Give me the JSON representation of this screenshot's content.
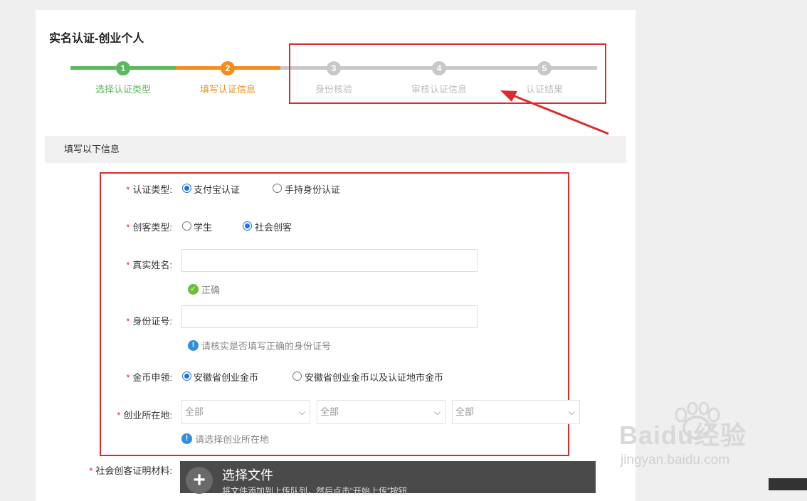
{
  "page": {
    "title": "实名认证-创业个人"
  },
  "steps": [
    {
      "number": "1",
      "label": "选择认证类型",
      "color": "#5cb85c"
    },
    {
      "number": "2",
      "label": "填写认证信息",
      "color": "#f28d1f"
    },
    {
      "number": "3",
      "label": "身份核验",
      "color": "#c8c8c8"
    },
    {
      "number": "4",
      "label": "审核认证信息",
      "color": "#c8c8c8"
    },
    {
      "number": "5",
      "label": "认证结果",
      "color": "#c8c8c8"
    }
  ],
  "section": {
    "heading": "填写以下信息"
  },
  "form": {
    "required_mark": "*",
    "auth_type": {
      "label": "认证类型:",
      "options": [
        "支付宝认证",
        "手持身份认证"
      ],
      "selected": "支付宝认证"
    },
    "maker_type": {
      "label": "创客类型:",
      "options": [
        "学生",
        "社会创客"
      ],
      "selected": "社会创客"
    },
    "real_name": {
      "label": "真实姓名:",
      "value": "",
      "hint": "正确"
    },
    "id_number": {
      "label": "身份证号:",
      "value": "",
      "hint": "请核实是否填写正确的身份证号"
    },
    "coin_claim": {
      "label": "金币申领:",
      "options": [
        "安徽省创业金币",
        "安徽省创业金币以及认证地市金币"
      ],
      "selected": "安徽省创业金币"
    },
    "location": {
      "label": "创业所在地:",
      "selects": [
        "全部",
        "全部",
        "全部"
      ],
      "hint": "请选择创业所在地"
    },
    "proof": {
      "label": "社会创客证明材料:"
    }
  },
  "upload": {
    "title": "选择文件",
    "subtitle": "将文件添加到上传队列，然后点击“开始上传”按钮"
  },
  "watermark": {
    "main": "Baidu经验",
    "sub": "jingyan.baidu.com"
  },
  "colors": {
    "annotation_red": "#e02a2a",
    "radio_blue": "#1a73e8"
  }
}
